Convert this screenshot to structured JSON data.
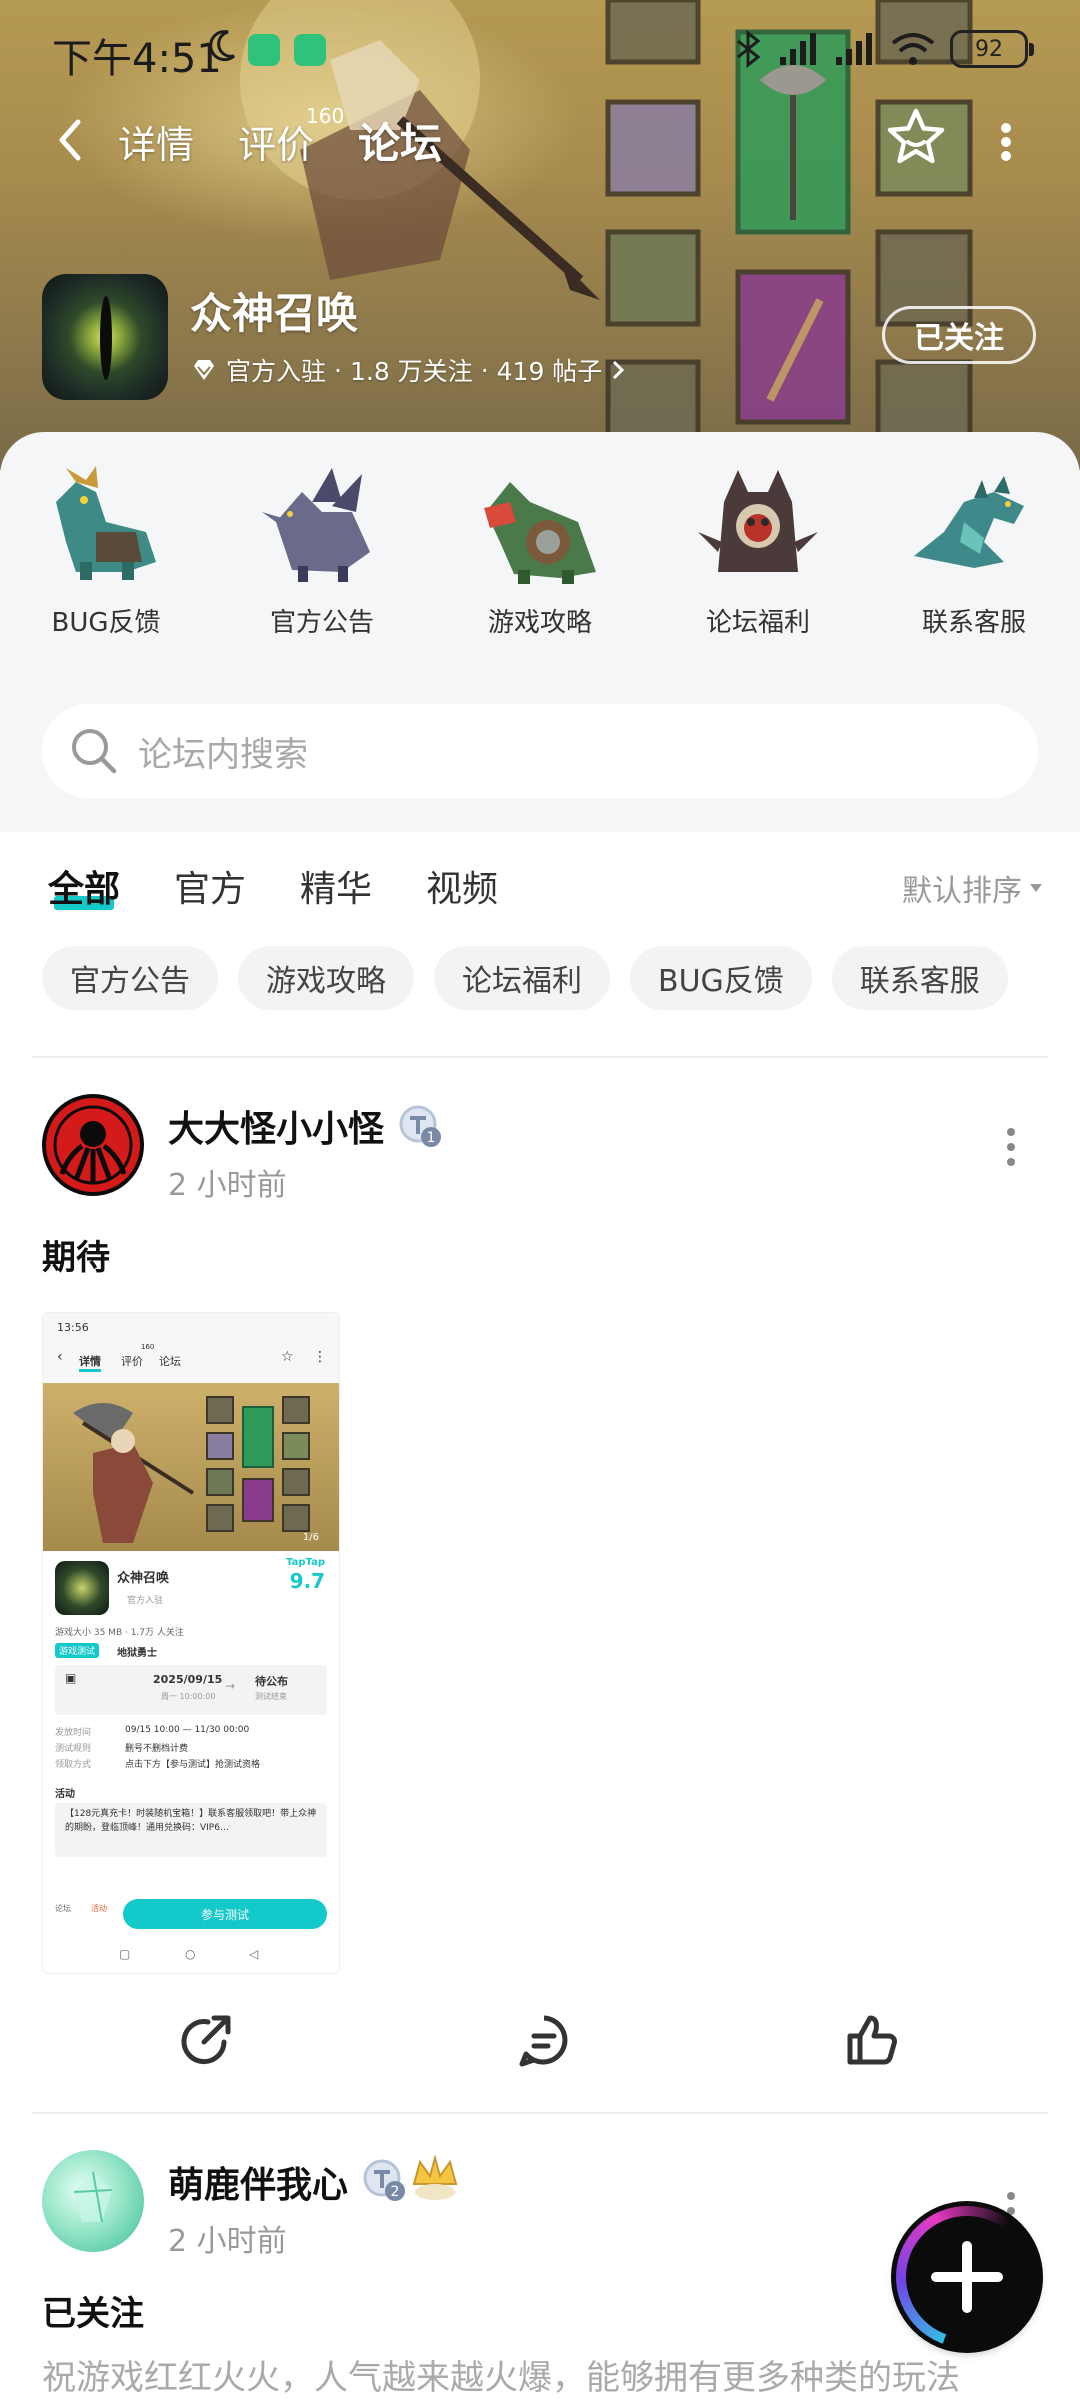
{
  "status_bar": {
    "time": "下午4:51",
    "battery": "92"
  },
  "header": {
    "tabs": [
      {
        "label": "详情"
      },
      {
        "label": "评价",
        "badge": "160"
      },
      {
        "label": "论坛"
      }
    ],
    "active_tab": "论坛",
    "accent_color": "#14c9c9"
  },
  "game": {
    "title": "众神召唤",
    "meta_official": "官方入驻",
    "meta_follow": "1.8 万关注",
    "meta_posts": "419 帖子",
    "follow_button": "已关注"
  },
  "categories": [
    {
      "label": "BUG反馈",
      "icon": "dragon-icon"
    },
    {
      "label": "官方公告",
      "icon": "dragon-icon"
    },
    {
      "label": "游戏攻略",
      "icon": "dragon-icon"
    },
    {
      "label": "论坛福利",
      "icon": "dragon-icon"
    },
    {
      "label": "联系客服",
      "icon": "dragon-icon"
    }
  ],
  "search": {
    "placeholder": "论坛内搜索"
  },
  "feed_tabs": [
    "全部",
    "官方",
    "精华",
    "视频"
  ],
  "feed_active_tab": "全部",
  "sort_label": "默认排序",
  "chips": [
    "官方公告",
    "游戏攻略",
    "论坛福利",
    "BUG反馈",
    "联系客服"
  ],
  "posts": [
    {
      "author": "大大怪小小怪",
      "level": "1",
      "time": "2 小时前",
      "content": "期待",
      "screenshot": {
        "time": "13:56",
        "tabs": [
          "详情",
          "评价",
          "论坛"
        ],
        "tab_badge": "160",
        "game_title": "众神召唤",
        "official": "官方入驻",
        "score_label": "TapTap",
        "score": "9.7",
        "stats": "游戏大小 35 MB · 1.7万 人关注",
        "test_tag": "游戏测试",
        "test_name": "地狱勇士",
        "date_start": "2025/09/15",
        "date_start_sub": "周一 10:00:00",
        "date_end": "待公布",
        "date_end_sub": "测试结束",
        "row1_label": "发放时间",
        "row1_value": "09/15 10:00 — 11/30 00:00",
        "row2_label": "测试规则",
        "row2_value": "删号不删档计费",
        "row3_label": "领取方式",
        "row3_value": "点击下方【参与测试】抢测试资格",
        "activity": "活动",
        "activity_text": "【128元真充卡！时装随机宝箱！】联系客服领取吧！带上众神的期盼，登临顶峰！通用兑换码：VIP6…",
        "bottom_left": "论坛",
        "bottom_mid": "活动",
        "join_button": "参与测试",
        "page_indicator": "1/6"
      }
    },
    {
      "author": "萌鹿伴我心",
      "level": "2",
      "time": "2 小时前",
      "content": "已关注",
      "body": "祝游戏红红火火，人气越来越火爆，能够拥有更多种类的玩法"
    }
  ]
}
